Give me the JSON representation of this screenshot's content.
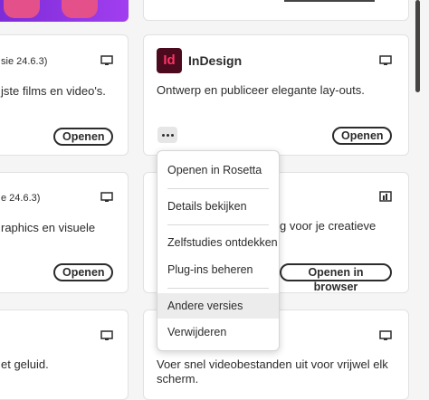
{
  "cards": {
    "left1": {
      "version": "sie 24.6.3)",
      "desc": "jste films en video's.",
      "button": "Openen"
    },
    "indesign": {
      "title": "InDesign",
      "logo_text": "Id",
      "desc": "Ontwerp en publiceer elegante lay-outs.",
      "button": "Openen"
    },
    "left2": {
      "version": "e 24.6.3)",
      "desc": "raphics en visuele",
      "button": "Openen"
    },
    "right2": {
      "desc": "g voor je creatieve",
      "button": "Openen in browser"
    },
    "left3": {
      "desc": "et geluid."
    },
    "right3": {
      "desc_line1": "Voer snel videobestanden uit voor vrijwel elk",
      "desc_line2": "scherm."
    }
  },
  "menu": {
    "items": [
      "Openen in Rosetta",
      "Details bekijken",
      "Zelfstudies ontdekken",
      "Plug-ins beheren",
      "Andere versies",
      "Verwijderen"
    ]
  },
  "colors": {
    "indesign_brand": "#4b0a1e",
    "indesign_text": "#ff3366"
  }
}
